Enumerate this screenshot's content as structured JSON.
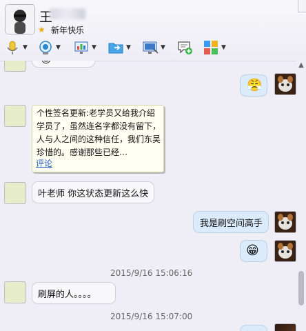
{
  "header": {
    "contact_name": "王",
    "status_text": "新年快乐"
  },
  "toolbar": {
    "items": [
      {
        "icon": "microphone-icon"
      },
      {
        "icon": "video-icon"
      },
      {
        "icon": "screen-share-icon"
      },
      {
        "icon": "file-transfer-icon"
      },
      {
        "icon": "remote-assist-icon"
      },
      {
        "icon": "message-add-icon"
      },
      {
        "icon": "apps-icon"
      }
    ]
  },
  "chat": {
    "signature_card": {
      "text": "个性签名更新:老学员又给我介绍学员了，虽然连名字都没有留下，人与人之间的这种信任，我们东吴珍惜的。感谢那些已经…",
      "link": "评论"
    },
    "messages": [
      {
        "side": "left",
        "text": "叶老师 你这状态更新这么快"
      },
      {
        "side": "right",
        "text": "我是刷空间高手"
      },
      {
        "side": "right",
        "text": "😁"
      },
      {
        "timestamp": "2015/9/16 15:06:16"
      },
      {
        "side": "left",
        "text": "刷屏的人。。。。"
      },
      {
        "timestamp": "2015/9/16 15:07:00"
      }
    ]
  }
}
